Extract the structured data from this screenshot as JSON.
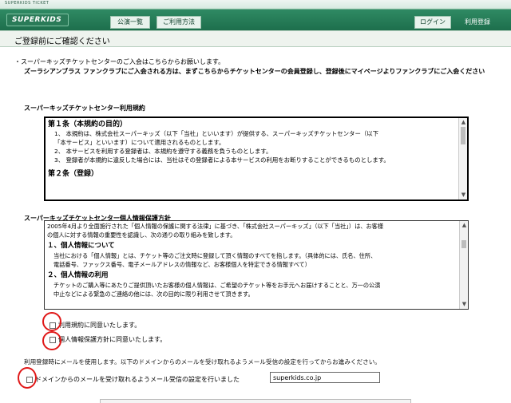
{
  "header": {
    "top_text": "SUPERKIDS TICKET",
    "logo_text": "SUPERKIDS",
    "nav": [
      "公演一覧",
      "ご利用方法"
    ],
    "login_label": "ログイン",
    "register_label": "利用登録"
  },
  "page": {
    "title": "ご登録前にご確認ください",
    "intro_line_1": "・スーパーキッズチケットセンターのご入会はこちらからお願いします。",
    "intro_line_2": "ズーラシアンブラス ファンクラブにご入会される方は、まずこちらからチケットセンターの会員登録し、登録後にマイページよりファンクラブにご入会ください"
  },
  "terms": {
    "title": "スーパーキッズチケットセンター利用規約",
    "article_1_title": "第１条（本規約の目的）",
    "article_1_lines": [
      "1、 本規約は、株式会社スーパーキッズ（以下「当社」といいます）が提供する、スーパーキッズチケットセンター（以下",
      "「本サービス」といいます）について適用されるものとします。",
      "2、 本サービスを利用する登録者は、本規約を遵守する義務を負うものとします。",
      "3、 登録者が本規約に違反した場合には、当社はその登録者による本サービスの利用をお断りすることができるものとします。"
    ],
    "article_2_title": "第２条（登録）"
  },
  "privacy": {
    "title": "スーパーキッズチケットセンター個人情報保護方針",
    "intro_lines": [
      "2005年4月より全面施行された「個人情報の保護に関する法律」に基づき、「株式会社スーパーキッズ」（以下「当社」）は、お客様",
      "の個人に対する情報の重要性を認識し、次の通りの取り組みを致します。"
    ],
    "section_1_title": "１、個人情報について",
    "section_1_lines": [
      "当社における「個人情報」とは、チケット等のご注文時に登録して頂く情報のすべてを指します。（具体的には、氏名、住所、",
      "電話番号、ファックス番号、電子メールアドレスの情報など、お客様個人を特定できる情報すべて）"
    ],
    "section_2_title": "２、個人情報の利用",
    "section_2_lines": [
      "チケットのご購入等にあたりご提供頂いたお客様の個人情報は、ご希望のチケット等をお手元へお届けすることと、万一の公演",
      "中止などによる緊急のご連絡の他には、次の目的に限り利用させて頂きます。"
    ]
  },
  "agreements": {
    "terms_label": "利用規約に同意いたします。",
    "privacy_label": "個人情報保護方針に同意いたします。",
    "mail_note": "利用登録時にメールを使用します。以下のドメインからのメールを受け取れるようメール受信の設定を行ってからお進みください。",
    "mail_label": "ドメインからのメールを受け取れるようメール受信の設定を行いました",
    "domain_value": "superkids.co.jp"
  },
  "colors": {
    "header_green": "#1d6e4c",
    "annotation_red": "#e01818"
  }
}
